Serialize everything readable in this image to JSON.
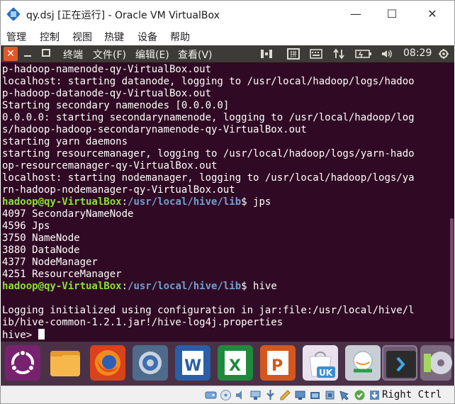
{
  "window": {
    "title": "qy.dsj [正在运行] - Oracle VM VirtualBox",
    "minimize_glyph": "—",
    "maximize_glyph": "☐",
    "close_glyph": "✕"
  },
  "vbox_menu": [
    "管理",
    "控制",
    "视图",
    "热键",
    "设备",
    "帮助"
  ],
  "ubuntu_panel": {
    "close_glyph": "✕",
    "menus": [
      "终端",
      "文件(F)",
      "编辑(E)",
      "查看(V)"
    ],
    "indicators": [
      "terminal-icon",
      "keyboard-icon",
      "network-updown-icon",
      "battery-icon",
      "volume-icon"
    ],
    "clock": "08:29",
    "power_icon": "gear-power-icon"
  },
  "terminal": {
    "lines": [
      [
        {
          "t": "p-hadoop-namenode-qy-VirtualBox.out",
          "c": "plain"
        }
      ],
      [
        {
          "t": "localhost: starting datanode, logging to /usr/local/hadoop/logs/hadoo",
          "c": "plain"
        }
      ],
      [
        {
          "t": "p-hadoop-datanode-qy-VirtualBox.out",
          "c": "plain"
        }
      ],
      [
        {
          "t": "Starting secondary namenodes [0.0.0.0]",
          "c": "plain"
        }
      ],
      [
        {
          "t": "0.0.0.0: starting secondarynamenode, logging to /usr/local/hadoop/log",
          "c": "plain"
        }
      ],
      [
        {
          "t": "s/hadoop-hadoop-secondarynamenode-qy-VirtualBox.out",
          "c": "plain"
        }
      ],
      [
        {
          "t": "starting yarn daemons",
          "c": "plain"
        }
      ],
      [
        {
          "t": "starting resourcemanager, logging to /usr/local/hadoop/logs/yarn-hado",
          "c": "plain"
        }
      ],
      [
        {
          "t": "op-resourcemanager-qy-VirtualBox.out",
          "c": "plain"
        }
      ],
      [
        {
          "t": "localhost: starting nodemanager, logging to /usr/local/hadoop/logs/ya",
          "c": "plain"
        }
      ],
      [
        {
          "t": "rn-hadoop-nodemanager-qy-VirtualBox.out",
          "c": "plain"
        }
      ],
      [
        {
          "t": "hadoop@qy-VirtualBox",
          "c": "user"
        },
        {
          "t": ":",
          "c": "plain"
        },
        {
          "t": "/usr/local/hive/lib",
          "c": "path"
        },
        {
          "t": "$ jps",
          "c": "plain"
        }
      ],
      [
        {
          "t": "4097 SecondaryNameNode",
          "c": "plain"
        }
      ],
      [
        {
          "t": "4596 Jps",
          "c": "plain"
        }
      ],
      [
        {
          "t": "3750 NameNode",
          "c": "plain"
        }
      ],
      [
        {
          "t": "3880 DataNode",
          "c": "plain"
        }
      ],
      [
        {
          "t": "4377 NodeManager",
          "c": "plain"
        }
      ],
      [
        {
          "t": "4251 ResourceManager",
          "c": "plain"
        }
      ],
      [
        {
          "t": "hadoop@qy-VirtualBox",
          "c": "user"
        },
        {
          "t": ":",
          "c": "plain"
        },
        {
          "t": "/usr/local/hive/lib",
          "c": "path"
        },
        {
          "t": "$ hive",
          "c": "plain"
        }
      ],
      [
        {
          "t": "",
          "c": "plain"
        }
      ],
      [
        {
          "t": "Logging initialized using configuration in jar:file:/usr/local/hive/l",
          "c": "plain"
        }
      ],
      [
        {
          "t": "ib/hive-common-1.2.1.jar!/hive-log4j.properties",
          "c": "plain"
        }
      ],
      [
        {
          "t": "hive> ",
          "c": "plain"
        }
      ]
    ],
    "colors": {
      "background": "#300a24",
      "text": "#ffffff",
      "user": "#8ae234",
      "path": "#729fcf"
    }
  },
  "dock_apps": [
    {
      "name": "ubuntu-dash-icon",
      "label": "Dash"
    },
    {
      "name": "files-icon",
      "label": "Files"
    },
    {
      "name": "firefox-icon",
      "label": "Firefox"
    },
    {
      "name": "system-settings-icon",
      "label": "Settings"
    },
    {
      "name": "writer-icon",
      "label": "W"
    },
    {
      "name": "calc-icon",
      "label": "X"
    },
    {
      "name": "impress-icon",
      "label": "P"
    },
    {
      "name": "software-center-icon",
      "label": "UK"
    },
    {
      "name": "amazon-icon",
      "label": "Amazon"
    },
    {
      "name": "terminal-app-icon",
      "label": ">"
    },
    {
      "name": "dvd-icon",
      "label": "DVD"
    }
  ],
  "status_bar": {
    "icons": [
      "harddisk-icon",
      "optical-icon",
      "audio-icon",
      "network-icon",
      "usb-icon",
      "shared-folder-icon",
      "display-icon",
      "capture-icon",
      "cpu-icon",
      "mouse-integration-icon",
      "keyboard-capture-icon",
      "download-icon"
    ],
    "host_key": "Right Ctrl"
  }
}
